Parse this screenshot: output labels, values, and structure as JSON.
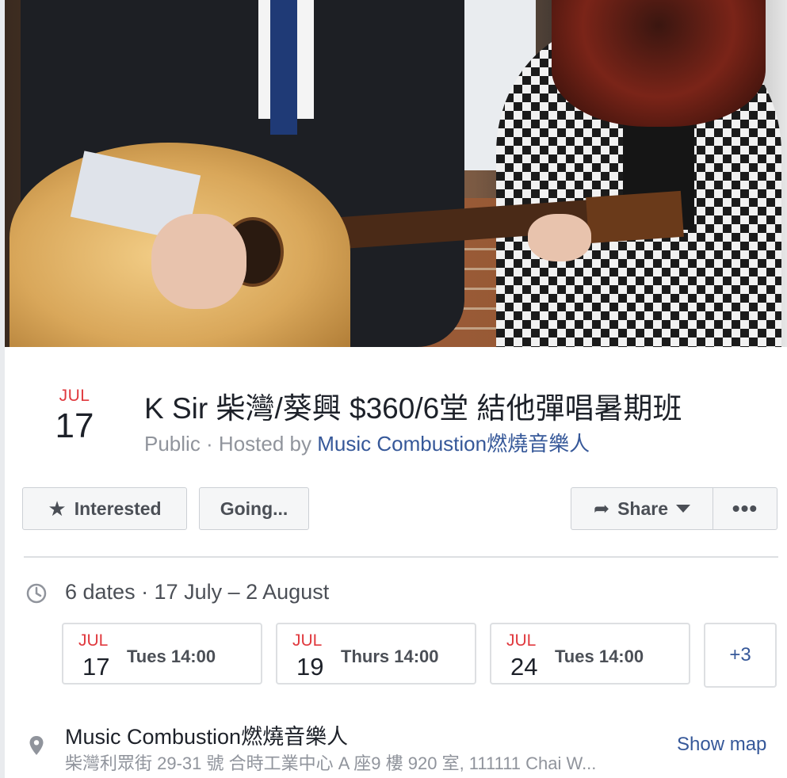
{
  "event": {
    "month": "JUL",
    "day": "17",
    "title": "K Sir 柴灣/葵興 $360/6堂 結他彈唱暑期班",
    "subtitle_prefix": "Public · Hosted by ",
    "host": "Music Combustion燃燒音樂人"
  },
  "actions": {
    "interested_label": "Interested",
    "going_label": "Going...",
    "share_label": "Share",
    "more_label": "•••"
  },
  "schedule": {
    "summary": "6 dates · 17 July – 2 August",
    "dates": [
      {
        "month": "JUL",
        "day": "17",
        "time": "Tues 14:00"
      },
      {
        "month": "JUL",
        "day": "19",
        "time": "Thurs 14:00"
      },
      {
        "month": "JUL",
        "day": "24",
        "time": "Tues 14:00"
      }
    ],
    "more_label": "+3"
  },
  "location": {
    "name": "Music Combustion燃燒音樂人",
    "address": "柴灣利眾街 29-31 號 合時工業中心 A 座9 樓 920 室, 111111 Chai W...",
    "show_map_label": "Show map"
  },
  "colors": {
    "month_red": "#e0393e",
    "link_blue": "#365899",
    "muted_gray": "#90949c"
  },
  "icons": {
    "interested": "star-icon",
    "share": "share-arrow-icon",
    "dropdown": "caret-down-icon",
    "more": "more-dots-icon",
    "time": "clock-icon",
    "location": "map-pin-icon"
  }
}
